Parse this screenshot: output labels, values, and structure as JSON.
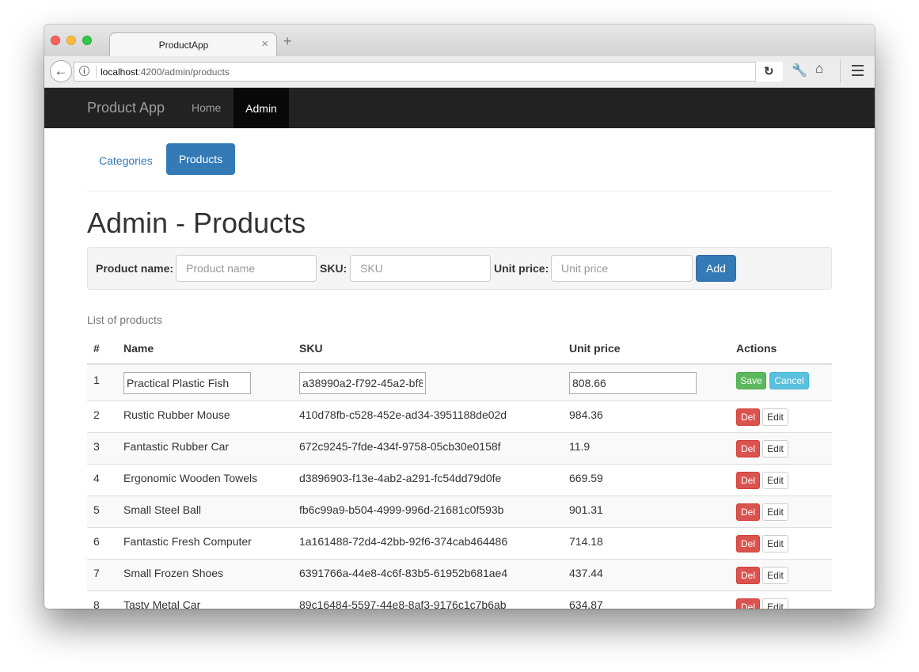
{
  "browser": {
    "tab_title": "ProductApp",
    "tab_close": "×",
    "new_tab": "+",
    "url_host": "localhost",
    "url_rest": ":4200/admin/products"
  },
  "navbar": {
    "brand": "Product App",
    "items": [
      "Home",
      "Admin"
    ],
    "active": "Admin"
  },
  "subnav": {
    "categories_label": "Categories",
    "products_label": "Products"
  },
  "page_title": "Admin - Products",
  "form": {
    "name_label": "Product name:",
    "name_placeholder": "Product name",
    "sku_label": "SKU:",
    "sku_placeholder": "SKU",
    "price_label": "Unit price:",
    "price_placeholder": "Unit price",
    "add_label": "Add"
  },
  "list_caption": "List of products",
  "table": {
    "headers": [
      "#",
      "Name",
      "SKU",
      "Unit price",
      "Actions"
    ],
    "editing_row": {
      "num": "1",
      "name": "Practical Plastic Fish",
      "sku": "a38990a2-f792-45a2-bf8",
      "price": "808.66",
      "save_label": "Save",
      "cancel_label": "Cancel"
    },
    "rows": [
      {
        "num": "2",
        "name": "Rustic Rubber Mouse",
        "sku": "410d78fb-c528-452e-ad34-3951188de02d",
        "price": "984.36"
      },
      {
        "num": "3",
        "name": "Fantastic Rubber Car",
        "sku": "672c9245-7fde-434f-9758-05cb30e0158f",
        "price": "11.9"
      },
      {
        "num": "4",
        "name": "Ergonomic Wooden Towels",
        "sku": "d3896903-f13e-4ab2-a291-fc54dd79d0fe",
        "price": "669.59"
      },
      {
        "num": "5",
        "name": "Small Steel Ball",
        "sku": "fb6c99a9-b504-4999-996d-21681c0f593b",
        "price": "901.31"
      },
      {
        "num": "6",
        "name": "Fantastic Fresh Computer",
        "sku": "1a161488-72d4-42bb-92f6-374cab464486",
        "price": "714.18"
      },
      {
        "num": "7",
        "name": "Small Frozen Shoes",
        "sku": "6391766a-44e8-4c6f-83b5-61952b681ae4",
        "price": "437.44"
      },
      {
        "num": "8",
        "name": "Tasty Metal Car",
        "sku": "89c16484-5597-44e8-8af3-9176c1c7b6ab",
        "price": "634.87"
      }
    ],
    "del_label": "Del",
    "edit_label": "Edit"
  }
}
